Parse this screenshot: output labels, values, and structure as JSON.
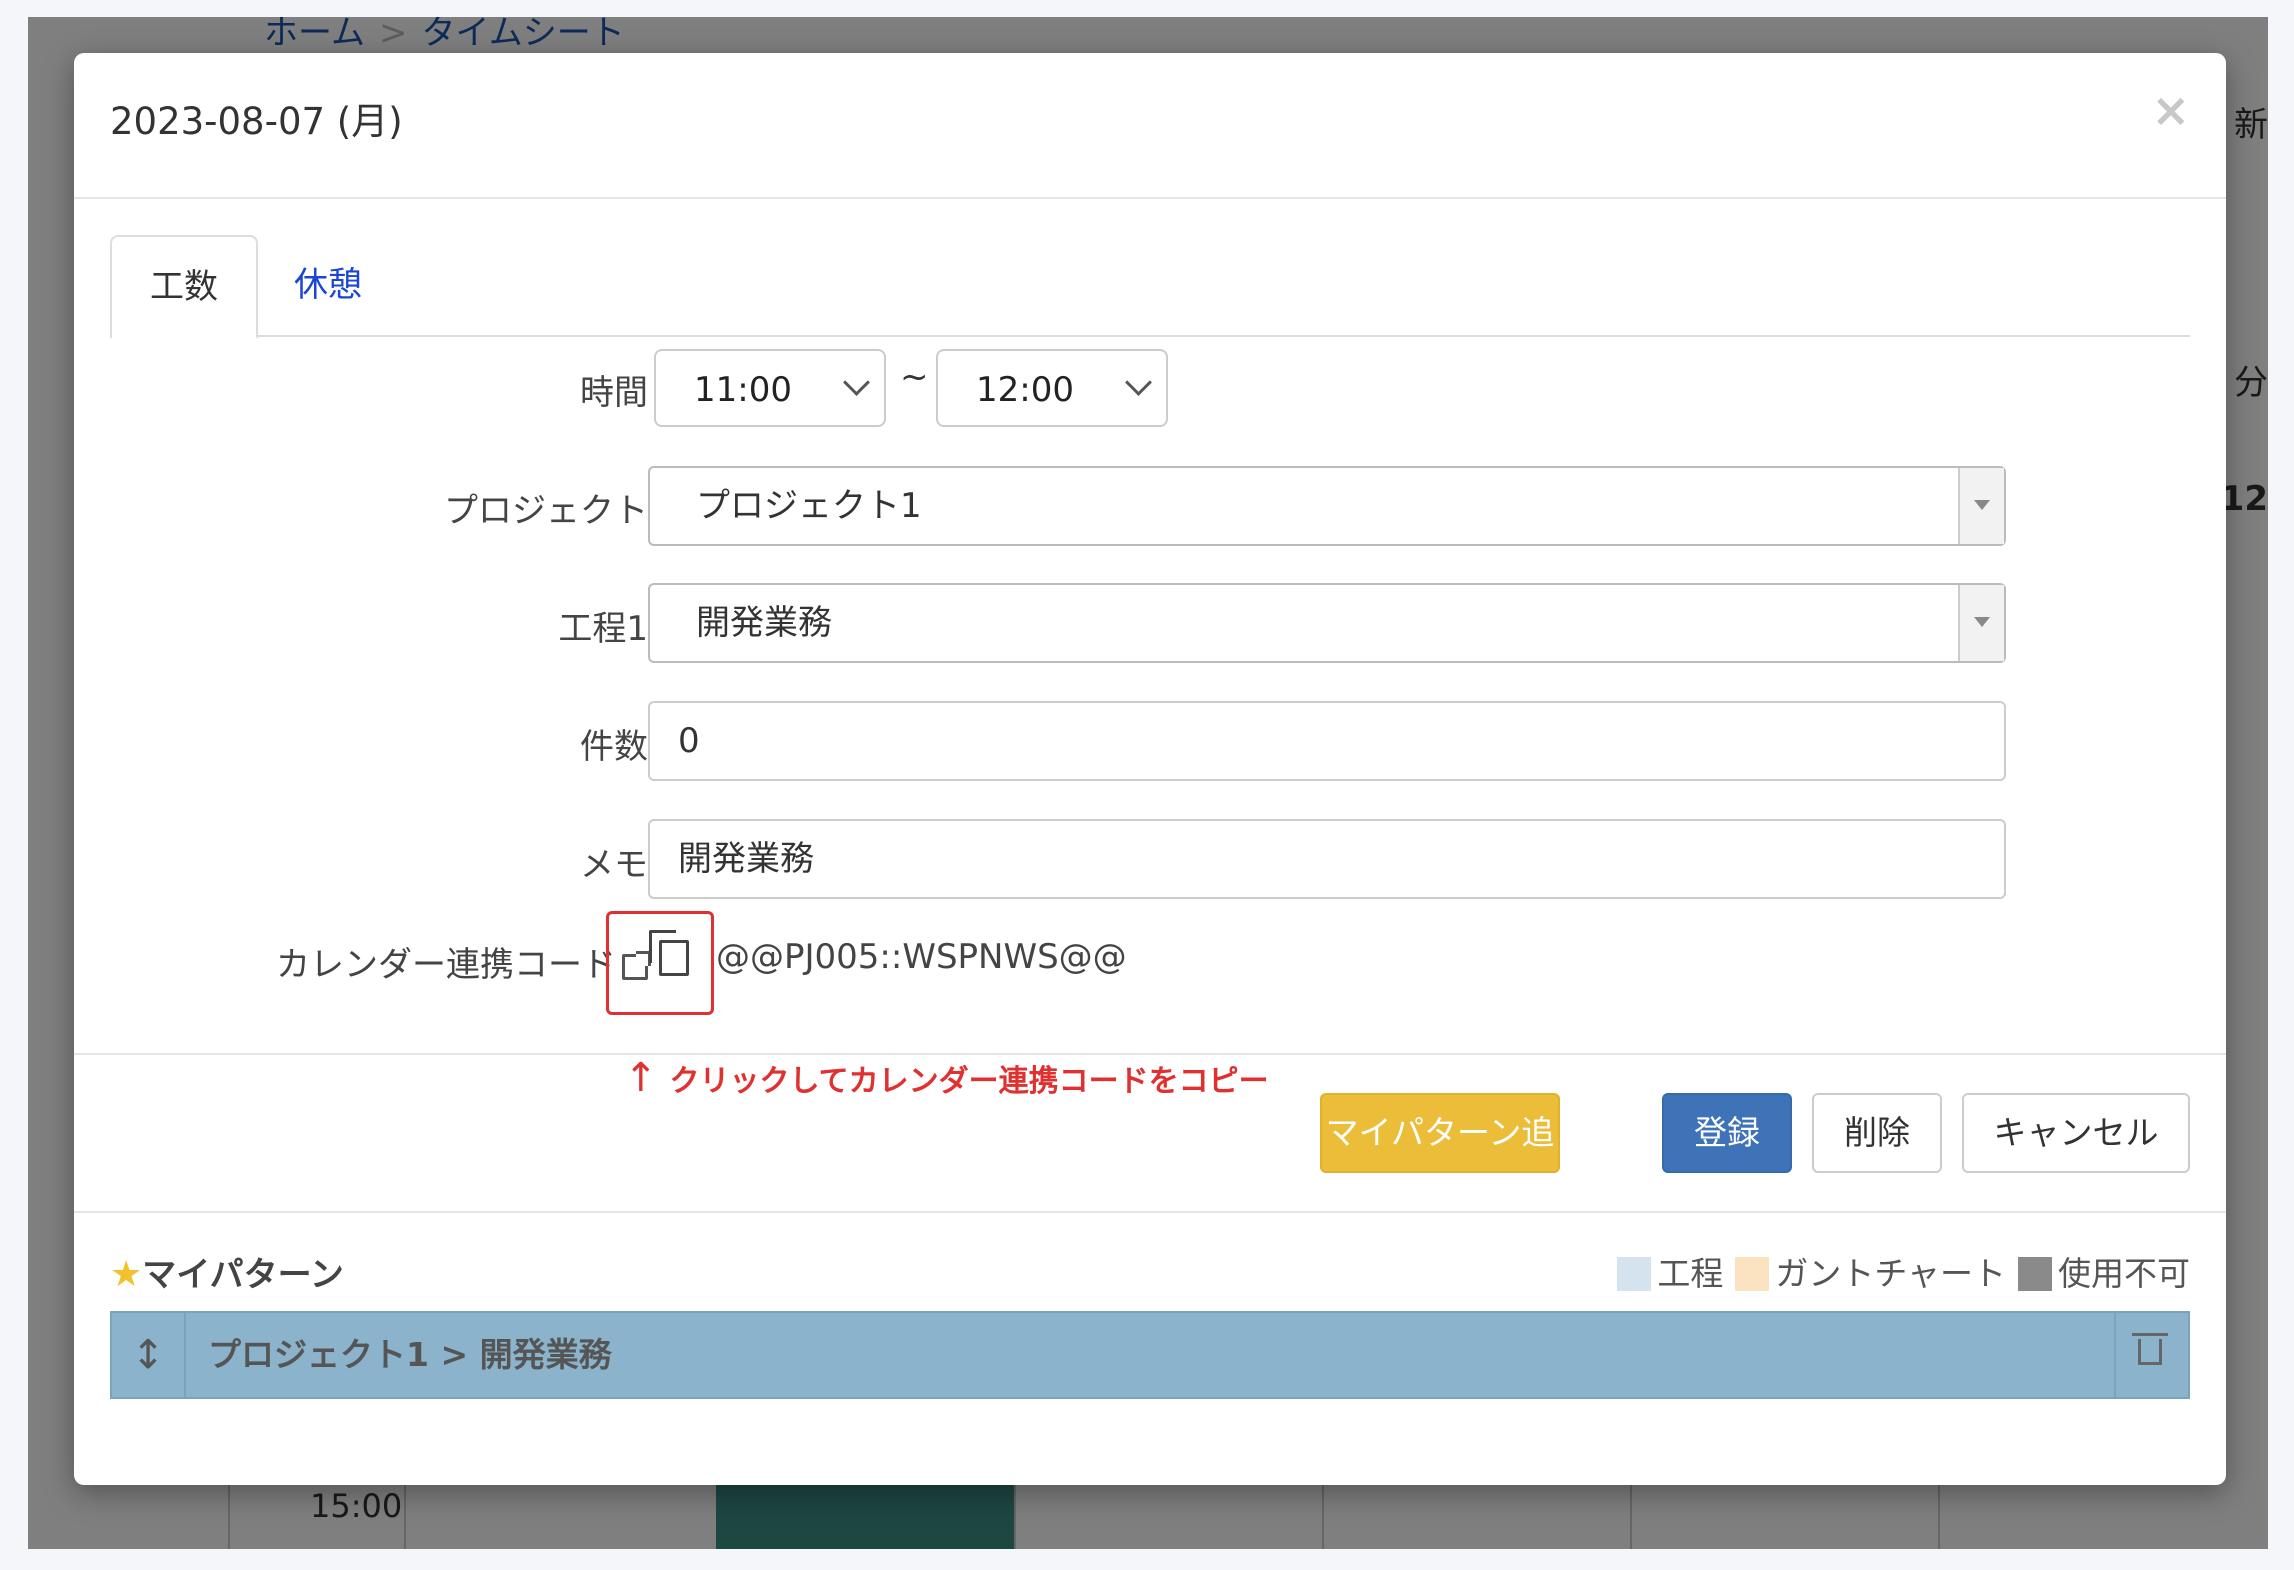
{
  "background": {
    "breadcrumb": [
      "ホーム",
      "タイムシート"
    ],
    "right_snippets": [
      "新",
      "分",
      "12"
    ],
    "time_row_label": "15:00"
  },
  "modal": {
    "title": "2023-08-07 (月)",
    "close_symbol": "×",
    "tabs": [
      {
        "label": "工数",
        "active": true
      },
      {
        "label": "休憩",
        "active": false
      }
    ],
    "form": {
      "time_label": "時間",
      "time_start": "11:00",
      "time_separator": "~",
      "time_end": "12:00",
      "project_label": "プロジェクト",
      "project_value": "プロジェクト1",
      "process_label": "工程1",
      "process_value": "開発業務",
      "count_label": "件数",
      "count_value": "0",
      "memo_label": "メモ",
      "memo_value": "開発業務",
      "calendar_code_label": "カレンダー連携コード",
      "calendar_code_value": "@@PJ005::WSPNWS@@"
    },
    "hint": {
      "arrow": "↑",
      "text": "クリックしてカレンダー連携コードをコピー"
    },
    "buttons": {
      "add_pattern": "マイパターン追加",
      "register": "登録",
      "delete": "削除",
      "cancel": "キャンセル"
    },
    "my_pattern": {
      "star": "★",
      "title": "マイパターン",
      "legend": [
        {
          "label": "工程",
          "color": "#d5e3ee"
        },
        {
          "label": "ガントチャート",
          "color": "#fbe2c1"
        },
        {
          "label": "使用不可",
          "color": "#8a8a8a"
        }
      ],
      "rows": [
        {
          "handle": "↕",
          "text": "プロジェクト1 > 開発業務"
        }
      ]
    }
  },
  "colors": {
    "accent_warning": "#ebbd38",
    "accent_primary": "#3f73b7",
    "highlight_red": "#e03030",
    "pattern_row": "#8bb3cb"
  }
}
